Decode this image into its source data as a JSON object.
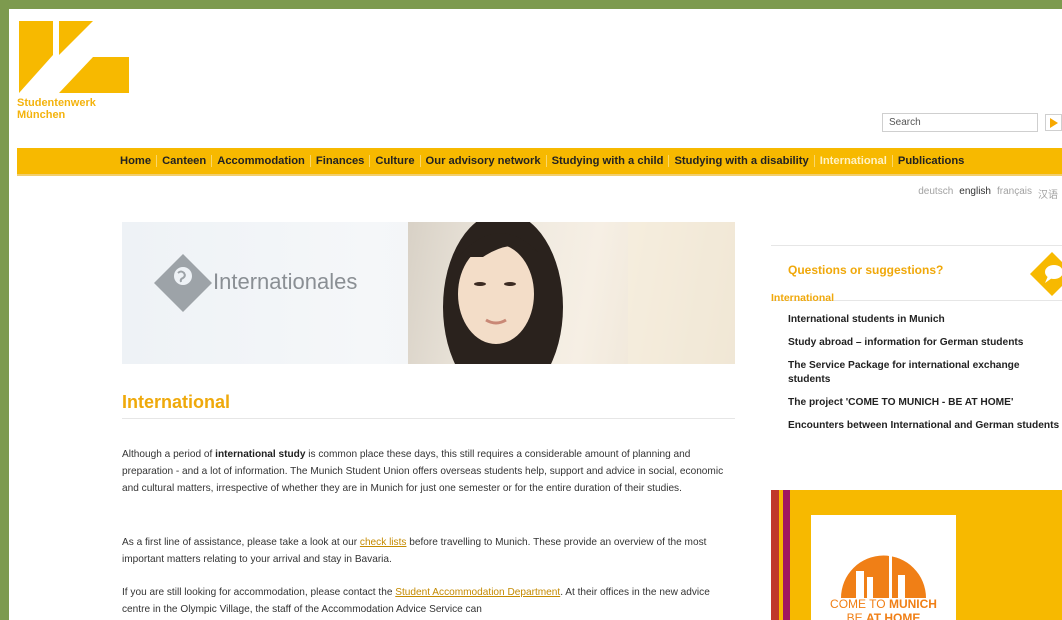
{
  "brand": {
    "line1": "Studentenwerk",
    "line2": "München"
  },
  "search": {
    "placeholder": "Search"
  },
  "nav": [
    {
      "label": "Home"
    },
    {
      "label": "Canteen"
    },
    {
      "label": "Accommodation"
    },
    {
      "label": "Finances"
    },
    {
      "label": "Culture"
    },
    {
      "label": "Our advisory network"
    },
    {
      "label": "Studying with a child"
    },
    {
      "label": "Studying with a disability"
    },
    {
      "label": "International"
    },
    {
      "label": "Publications"
    }
  ],
  "languages": [
    "deutsch",
    "english",
    "français",
    "汉语"
  ],
  "selected_language": "english",
  "hero": {
    "title": "Internationales"
  },
  "main": {
    "title": "International",
    "p1_pre": "Although a period of ",
    "p1_bold": "international study",
    "p1_post": " is common place these days, this still requires a considerable amount of planning and preparation - and a lot of information. The Munich Student Union offers overseas students help, support and advice in social, economic and cultural matters, irrespective of whether they are in Munich for just one semester or for the entire duration of their studies.",
    "p2_pre": "As a first line of assistance, please take a look at our ",
    "p2_link": "check lists",
    "p2_post": " before travelling to Munich. These provide an overview of the most important matters relating to your arrival and stay in Bavaria.",
    "p3_pre": "If you are still looking for accommodation, please contact the ",
    "p3_link": "Student Accommodation Department",
    "p3_post": ". At their offices in the new advice centre in the Olympic Village, the staff of the Accommodation Advice Service can"
  },
  "sidebar": {
    "questions": "Questions or suggestions?",
    "heading": "International",
    "items": [
      {
        "label": "International students in Munich"
      },
      {
        "label": "Study abroad – information for German students"
      },
      {
        "label": "The Service Package for international exchange students"
      },
      {
        "label": "The project 'COME TO MUNICH - BE AT HOME'"
      },
      {
        "label": "Encounters between International and German students"
      }
    ],
    "promo_line1_a": "COME TO ",
    "promo_line1_b": "MUNICH",
    "promo_line2_a": "BE ",
    "promo_line2_b": "AT HOME"
  },
  "colors": {
    "accent": "#f7b900",
    "orange": "#f0a80a",
    "frame": "#7d9a4e"
  }
}
